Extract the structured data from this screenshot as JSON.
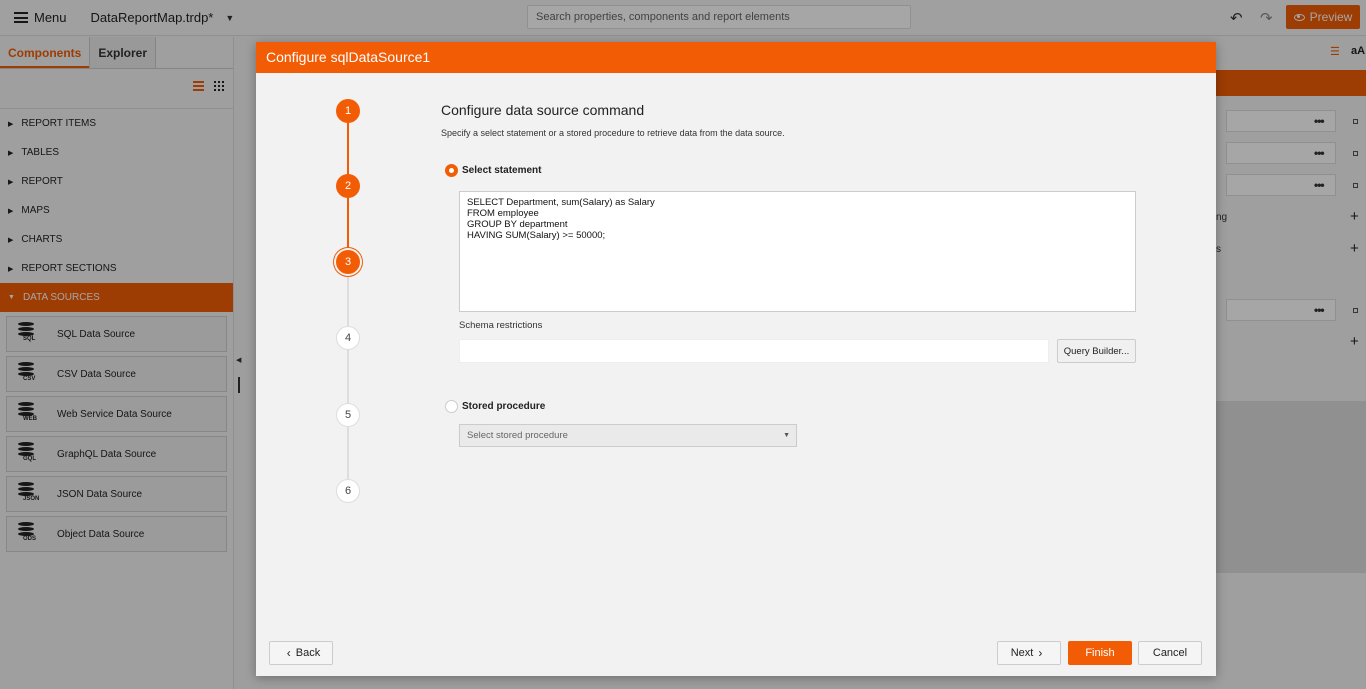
{
  "topbar": {
    "menu_label": "Menu",
    "doc_title": "DataReportMap.trdp*",
    "search_placeholder": "Search properties, components and report elements",
    "preview_label": "Preview"
  },
  "leftpanel": {
    "tabs": [
      {
        "label": "Components",
        "active": true
      },
      {
        "label": "Explorer",
        "active": false
      }
    ],
    "categories": [
      {
        "label": "REPORT ITEMS"
      },
      {
        "label": "TABLES"
      },
      {
        "label": "REPORT"
      },
      {
        "label": "MAPS"
      },
      {
        "label": "CHARTS"
      },
      {
        "label": "REPORT SECTIONS"
      },
      {
        "label": "DATA SOURCES"
      }
    ],
    "data_sources": [
      {
        "label": "SQL Data Source",
        "tag": "SQL"
      },
      {
        "label": "CSV Data Source",
        "tag": "CSV"
      },
      {
        "label": "Web Service Data Source",
        "tag": "WEB"
      },
      {
        "label": "GraphQL Data Source",
        "tag": "GQL"
      },
      {
        "label": "JSON Data Source",
        "tag": "JSON"
      },
      {
        "label": "Object Data Source",
        "tag": "ODS"
      }
    ]
  },
  "rightpanel": {
    "icon_label": "aA",
    "partial_text_1": "ng",
    "partial_text_2": "s"
  },
  "dialog": {
    "title": "Configure sqlDataSource1",
    "steps": [
      "1",
      "2",
      "3",
      "4",
      "5",
      "6"
    ],
    "current_step": 3,
    "heading": "Configure data source command",
    "subheading": "Specify a select statement or a stored procedure to retrieve data from the data source.",
    "select_statement_label": "Select statement",
    "sql_text": "SELECT Department, sum(Salary) as Salary\nFROM employee\nGROUP BY department\nHAVING SUM(Salary) >= 50000;",
    "schema_label": "Schema restrictions",
    "schema_value": "",
    "query_builder_label": "Query Builder...",
    "stored_procedure_label": "Stored procedure",
    "stored_procedure_placeholder": "Select stored procedure",
    "back_label": "Back",
    "next_label": "Next",
    "finish_label": "Finish",
    "cancel_label": "Cancel"
  },
  "colors": {
    "accent": "#f25c05"
  }
}
